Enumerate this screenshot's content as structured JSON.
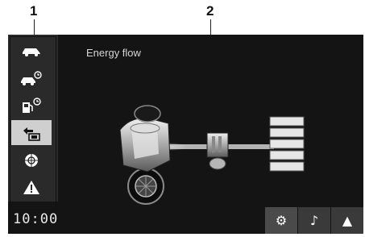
{
  "callouts": [
    "1",
    "2"
  ],
  "screen": {
    "title": "Energy flow",
    "clock": "10:00"
  },
  "sidebar": {
    "items": [
      {
        "icon": "car-icon",
        "active": false
      },
      {
        "icon": "car-timer-icon",
        "active": false
      },
      {
        "icon": "fuel-timer-icon",
        "active": false
      },
      {
        "icon": "energy-flow-icon",
        "active": true
      },
      {
        "icon": "wheel-icon",
        "active": false
      },
      {
        "icon": "warning-icon",
        "active": false
      }
    ]
  },
  "bottom_bar": {
    "buttons": [
      {
        "icon": "settings-icon",
        "glyph": "⚙"
      },
      {
        "icon": "music-note-icon",
        "glyph": "♪"
      },
      {
        "icon": "navigation-icon",
        "glyph": "▲"
      }
    ]
  },
  "colors": {
    "screen_bg": "#141414",
    "sidebar_bg": "#2a2a2a",
    "active_item_bg": "#cfcfcf",
    "text": "#d6d6d6"
  }
}
